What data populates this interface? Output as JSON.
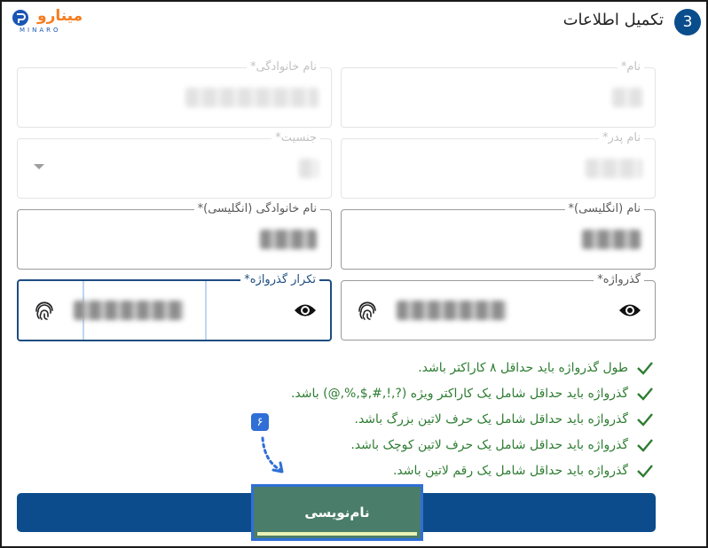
{
  "header": {
    "step_number": "3",
    "section_title": "تکمیل اطلاعات",
    "logo_text": "مینارو",
    "logo_sub": "MINARO"
  },
  "fields": {
    "first_name": {
      "label": "نام*",
      "value": "████",
      "disabled": true
    },
    "last_name": {
      "label": "نام خانوادگی*",
      "value": "████ ██████",
      "disabled": true
    },
    "father_name": {
      "label": "نام پدر*",
      "value": "█████",
      "disabled": true
    },
    "gender": {
      "label": "جنسیت*",
      "value": "██",
      "disabled": true
    },
    "first_name_en": {
      "label": "نام (انگلیسی)*",
      "value": "██████"
    },
    "last_name_en": {
      "label": "نام خانوادگی (انگلیسی)*",
      "value": "██████"
    },
    "password": {
      "label": "گذرواژه*",
      "value": "████████████"
    },
    "password_repeat": {
      "label": "تکرار گذرواژه*",
      "value": "████████████"
    }
  },
  "rules": [
    "طول گذرواژه باید حداقل ۸ کاراکتر باشد.",
    "گذرواژه باید حداقل شامل یک کاراکتر ویژه (?,!,#,$,%,@) باشد.",
    "گذرواژه باید حداقل شامل یک حرف لاتین بزرگ باشد.",
    "گذرواژه باید حداقل شامل یک حرف لاتین کوچک باشد.",
    "گذرواژه باید حداقل شامل یک رقم لاتین باشد."
  ],
  "annotation": {
    "step_label": "۶"
  },
  "submit": {
    "label": "نام‌نویسی"
  },
  "colors": {
    "primary": "#0d4c8c",
    "success": "#2e7d32",
    "highlight_button": "#4a7d6a",
    "annotation_blue": "#2f6fd6",
    "logo_orange": "#f57c1f"
  }
}
